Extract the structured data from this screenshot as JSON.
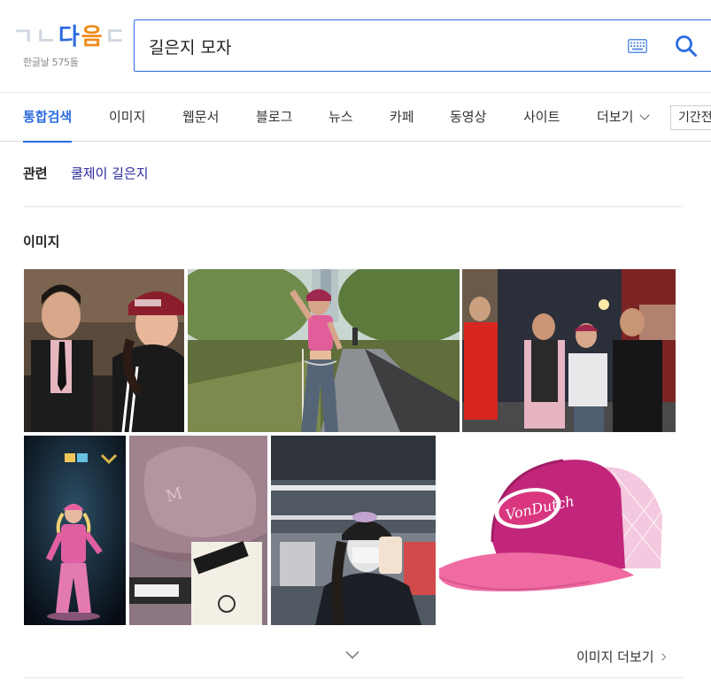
{
  "logo": {
    "letters": [
      {
        "char": "ㄱ",
        "color": "#cfd6df"
      },
      {
        "char": "ㄴ",
        "color": "#cfd6df"
      },
      {
        "char": "다",
        "color": "#2f6be0"
      },
      {
        "char": "음",
        "color": "#ef8b1b"
      },
      {
        "char": "ㄷ",
        "color": "#cfd6df"
      }
    ],
    "subtitle": "한글날 575돌"
  },
  "search": {
    "query": "길은지 모자",
    "accent": "#2b6cdf"
  },
  "tabs": [
    {
      "label": "통합검색",
      "active": true
    },
    {
      "label": "이미지",
      "active": false
    },
    {
      "label": "웹문서",
      "active": false
    },
    {
      "label": "블로그",
      "active": false
    },
    {
      "label": "뉴스",
      "active": false
    },
    {
      "label": "카페",
      "active": false
    },
    {
      "label": "동영상",
      "active": false
    },
    {
      "label": "사이트",
      "active": false
    },
    {
      "label": "더보기",
      "active": false
    }
  ],
  "period_filter": "기간전체",
  "related": {
    "label": "관련",
    "links": [
      "쿨제이 길은지"
    ]
  },
  "images": {
    "section_title": "이미지",
    "thumbnails": [
      {
        "icon": "photo-couple-bar"
      },
      {
        "icon": "photo-woman-park"
      },
      {
        "icon": "photo-group-street"
      },
      {
        "icon": "photo-dancer-stage"
      },
      {
        "icon": "photo-pink-cap-closeup"
      },
      {
        "icon": "photo-mirror-selfie"
      },
      {
        "icon": "photo-von-dutch-cap"
      }
    ],
    "more_label": "이미지 더보기"
  }
}
